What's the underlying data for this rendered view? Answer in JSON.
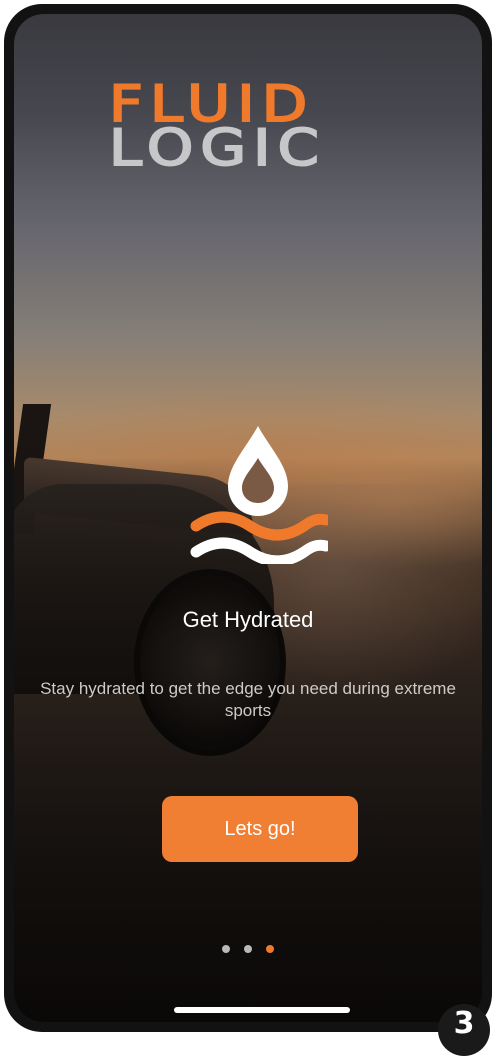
{
  "logo": {
    "line1": "FLUID",
    "line2": "LOGIC"
  },
  "onboarding": {
    "icon": "water-drop-waves-icon",
    "title": "Get Hydrated",
    "description": "Stay hydrated to get the edge you need  during extreme sports",
    "cta_label": "Lets go!"
  },
  "pagination": {
    "total": 3,
    "current": 3
  },
  "step_badge": "3",
  "colors": {
    "brand_orange": "#f07a2b",
    "logo_gray": "#c7c7c9",
    "button": "#f07f33",
    "dot_inactive": "#b9b9b9"
  }
}
